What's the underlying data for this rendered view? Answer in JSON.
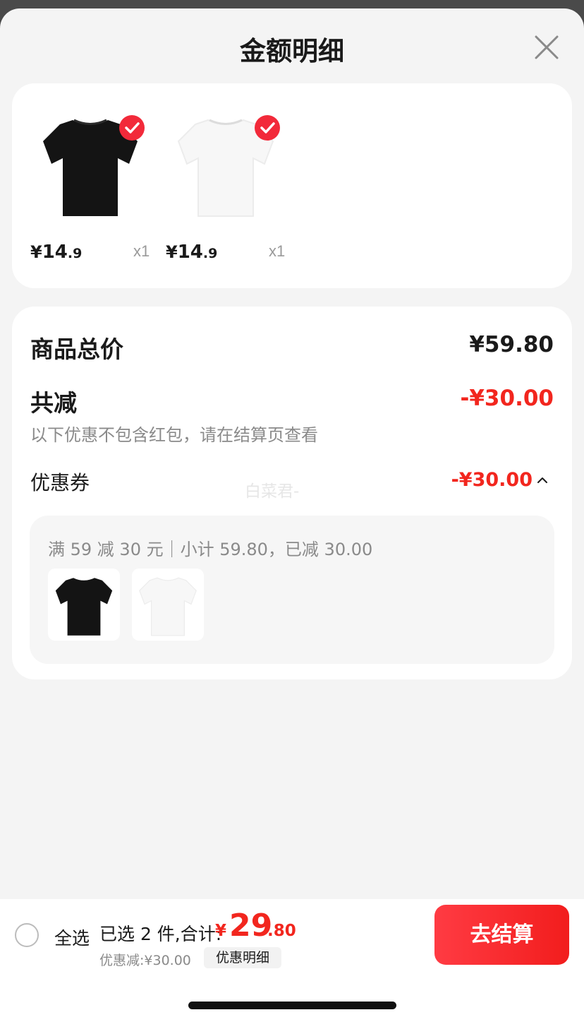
{
  "header": {
    "title": "金额明细"
  },
  "products": [
    {
      "color": "black",
      "currency": "¥",
      "price_int": "14",
      "price_dec": ".9",
      "qty": "x1"
    },
    {
      "color": "white",
      "currency": "¥",
      "price_int": "14",
      "price_dec": ".9",
      "qty": "x1"
    }
  ],
  "summary": {
    "total_label": "商品总价",
    "total_value": "¥59.80",
    "reduce_label": "共减",
    "reduce_value": "-¥30.00",
    "note": "以下优惠不包含红包，请在结算页查看",
    "coupon_label": "优惠券",
    "coupon_value": "-¥30.00",
    "watermark": "白菜君-",
    "coupon_desc": "满 59 减 30 元｜小计 59.80，已减 30.00"
  },
  "bottom_bar": {
    "select_all": "全选",
    "selected_text": "已选 2 件,合计:",
    "currency": "¥",
    "amount_int": "29",
    "amount_dec": ".80",
    "discount_text": "优惠减:¥30.00",
    "detail_button": "优惠明细",
    "checkout_button": "去结算"
  },
  "colors": {
    "accent": "#f2261e",
    "check": "#f22a3a"
  }
}
